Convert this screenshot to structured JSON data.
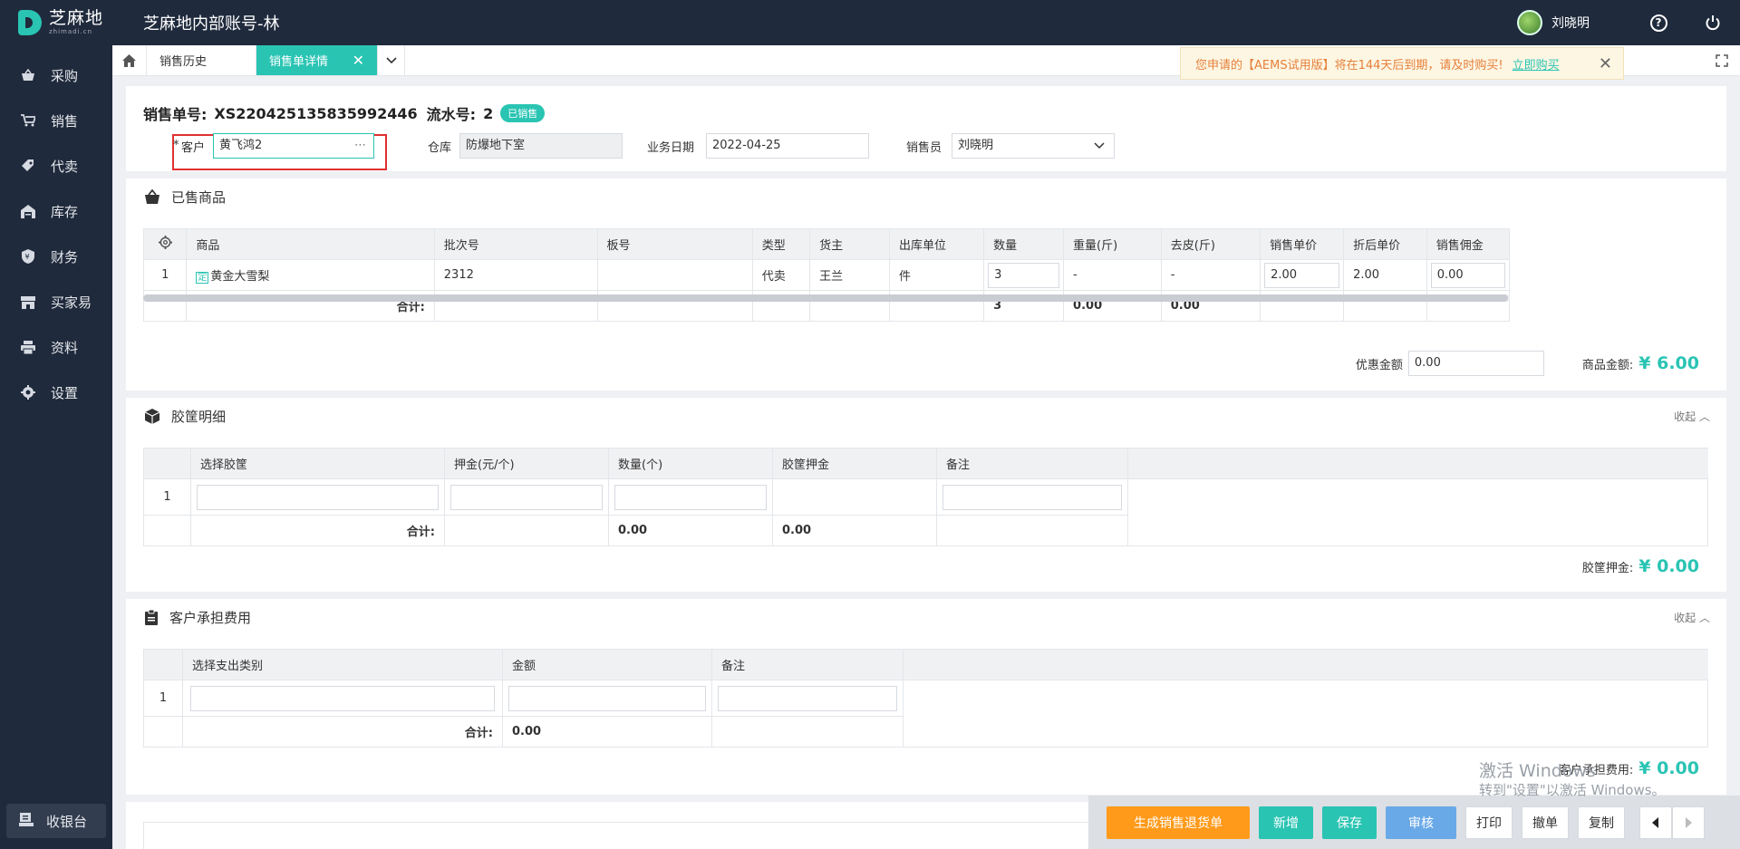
{
  "app": {
    "logo_cn": "芝麻地",
    "logo_en": "zhimadi.cn",
    "title": "芝麻地内部账号-林",
    "user_name": "刘晓明"
  },
  "sidebar": {
    "items": [
      {
        "label": "采购",
        "icon": "basket-icon"
      },
      {
        "label": "销售",
        "icon": "cart-icon"
      },
      {
        "label": "代卖",
        "icon": "tag-icon"
      },
      {
        "label": "库存",
        "icon": "warehouse-icon"
      },
      {
        "label": "财务",
        "icon": "finance-icon"
      },
      {
        "label": "买家易",
        "icon": "store-icon"
      },
      {
        "label": "资料",
        "icon": "printer-icon"
      },
      {
        "label": "设置",
        "icon": "gear-icon"
      }
    ],
    "cashier": "收银台"
  },
  "tabs": {
    "inactive": "销售历史",
    "active": "销售单详情"
  },
  "notice": {
    "text": "您申请的【AEMS试用版】将在144天后到期，请及时购买!",
    "link": "立即购买"
  },
  "order": {
    "no_label": "销售单号:",
    "no_value": "XS220425135835992446",
    "serial_label": "流水号:",
    "serial_value": "2",
    "status": "已销售",
    "customer_label": "客户",
    "customer_value": "黄飞鸿2",
    "warehouse_label": "仓库",
    "warehouse_value": "防爆地下室",
    "date_label": "业务日期",
    "date_value": "2022-04-25",
    "salesman_label": "销售员",
    "salesman_value": "刘晓明"
  },
  "goods": {
    "title": "已售商品",
    "headers": [
      "商品",
      "批次号",
      "板号",
      "类型",
      "货主",
      "出库单位",
      "数量",
      "重量(斤)",
      "去皮(斤)",
      "销售单价",
      "折后单价",
      "销售佣金"
    ],
    "row": {
      "index": "1",
      "tag": "定",
      "name": "黄金大雪梨",
      "batch": "2312",
      "board": "",
      "type": "代卖",
      "owner": "王兰",
      "unit": "件",
      "qty": "3",
      "weight": "-",
      "tare": "-",
      "price": "2.00",
      "discount_price": "2.00",
      "commission": "0.00"
    },
    "sum_label": "合计:",
    "sum_qty": "3",
    "sum_weight": "0.00",
    "sum_tare": "0.00",
    "discount_label": "优惠金额",
    "discount_value": "0.00",
    "amount_label": "商品金额:",
    "amount_value": "¥ 6.00"
  },
  "crates": {
    "title": "胶筐明细",
    "collapse": "收起",
    "headers": [
      "选择胶筐",
      "押金(元/个)",
      "数量(个)",
      "胶筐押金",
      "备注"
    ],
    "index": "1",
    "sum_label": "合计:",
    "sum_qty": "0.00",
    "sum_deposit": "0.00",
    "deposit_label": "胶筐押金:",
    "deposit_value": "¥ 0.00"
  },
  "fees": {
    "title": "客户承担费用",
    "collapse": "收起",
    "headers": [
      "选择支出类别",
      "金额",
      "备注"
    ],
    "index": "1",
    "sum_label": "合计:",
    "sum_amount": "0.00",
    "total_label": "客户承担费用:",
    "total_value": "¥ 0.00"
  },
  "watermark": {
    "line1": "激活 Windows",
    "line2": "转到\"设置\"以激活 Windows。"
  },
  "toolbar": {
    "return_label": "生成销售退货单",
    "new_label": "新增",
    "save_label": "保存",
    "audit_label": "审核",
    "print_label": "打印",
    "revoke_label": "撤单",
    "copy_label": "复制"
  },
  "colors": {
    "accent": "#2ac4b3",
    "sidebar_bg": "#1f2a3c",
    "orange": "#ff9a1a",
    "highlight": "#e03030"
  }
}
